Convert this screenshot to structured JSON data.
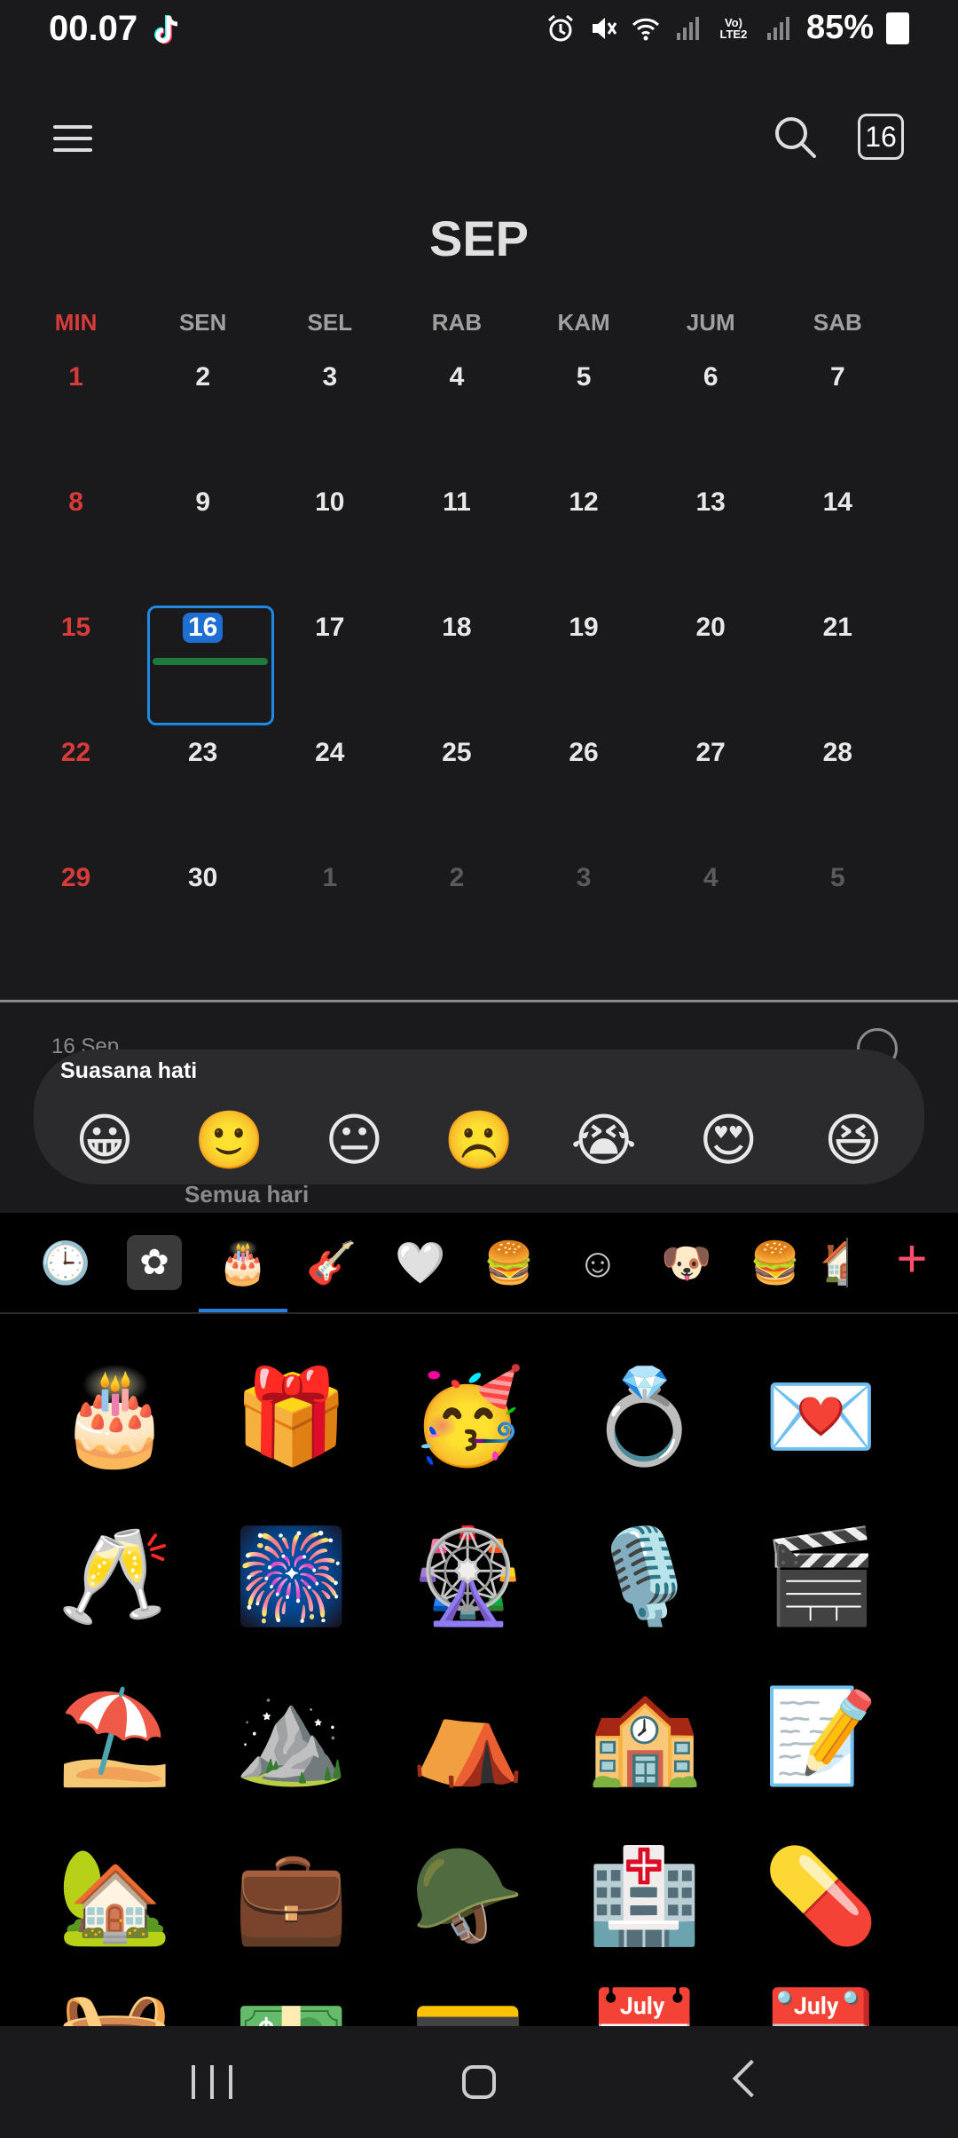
{
  "status": {
    "time": "00.07",
    "network_label": "Vo) LTE2",
    "battery": "85%"
  },
  "header": {
    "today_badge": "16",
    "month": "SEP"
  },
  "weekdays": [
    "MIN",
    "SEN",
    "SEL",
    "RAB",
    "KAM",
    "JUM",
    "SAB"
  ],
  "weeks": [
    [
      "1",
      "2",
      "3",
      "4",
      "5",
      "6",
      "7"
    ],
    [
      "8",
      "9",
      "10",
      "11",
      "12",
      "13",
      "14"
    ],
    [
      "15",
      "16",
      "17",
      "18",
      "19",
      "20",
      "21"
    ],
    [
      "22",
      "23",
      "24",
      "25",
      "26",
      "27",
      "28"
    ],
    [
      "29",
      "30",
      "1",
      "2",
      "3",
      "4",
      "5"
    ]
  ],
  "peek": {
    "date": "16 Sep"
  },
  "mood": {
    "label": "Suasana hati",
    "faces": [
      "😀",
      "🙂",
      "😐",
      "☹️",
      "😭",
      "😍",
      "😆"
    ]
  },
  "all_day": "Semua hari",
  "sticker_tabs": [
    "🕒",
    "✿",
    "🎂",
    "🎸",
    "🤍",
    "🍔",
    "☺",
    "🐶",
    "🍔",
    "🏠"
  ],
  "stickers": [
    "🎂",
    "🎁",
    "🥳",
    "💍",
    "💌",
    "🥂",
    "🎆",
    "🎡",
    "🎙️",
    "🎬",
    "⛱️",
    "⛰️",
    "⛺",
    "🏫",
    "📝",
    "🏡",
    "💼",
    "🪖",
    "🏥",
    "💊"
  ],
  "stickers_partial": [
    "🧺",
    "💵",
    "💳",
    "📅",
    "📆"
  ]
}
